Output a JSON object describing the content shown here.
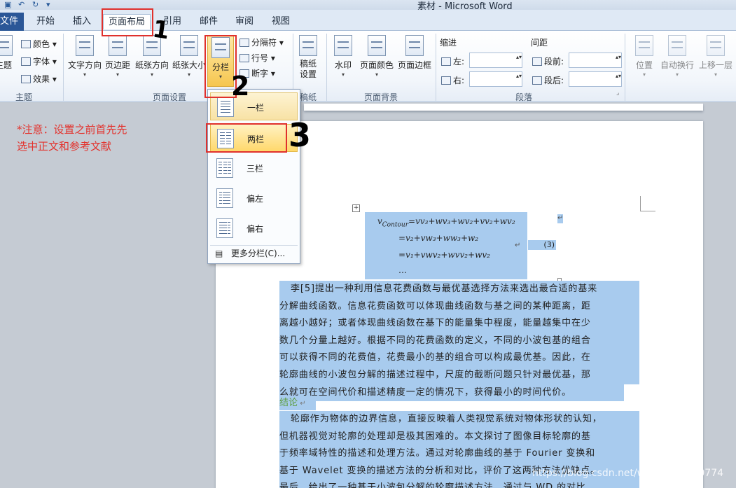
{
  "window": {
    "title": "素材 - Microsoft Word"
  },
  "tabs": [
    {
      "label": "文件"
    },
    {
      "label": "开始"
    },
    {
      "label": "插入"
    },
    {
      "label": "页面布局"
    },
    {
      "label": "引用"
    },
    {
      "label": "邮件"
    },
    {
      "label": "审阅"
    },
    {
      "label": "视图"
    }
  ],
  "ribbon": {
    "theme_group": {
      "label": "主题",
      "theme_button": "主题",
      "colors": "颜色",
      "fonts": "字体",
      "effects": "效果"
    },
    "page_setup": {
      "label": "页面设置",
      "text_direction": "文字方向",
      "margins": "页边距",
      "orientation": "纸张方向",
      "size": "纸张大小",
      "columns": "分栏",
      "breaks": "分隔符",
      "line_numbers": "行号",
      "hyphenation": "断字"
    },
    "draft": {
      "label": "稿纸",
      "button": "稿纸设置"
    },
    "background": {
      "label": "页面背景",
      "watermark": "水印",
      "page_color": "页面颜色",
      "page_borders": "页面边框"
    },
    "paragraph": {
      "label": "段落",
      "indent": "缩进",
      "left": "左:",
      "right": "右:",
      "spacing": "间距",
      "before": "段前:",
      "after": "段后:"
    },
    "arrange": {
      "position": "位置",
      "wrap": "自动换行",
      "bring_forward": "上移一层"
    }
  },
  "columns_menu": {
    "items": [
      {
        "label": "一栏",
        "columns": 1
      },
      {
        "label": "两栏",
        "columns": 2
      },
      {
        "label": "三栏",
        "columns": 3
      },
      {
        "label": "偏左",
        "columns": 2
      },
      {
        "label": "偏右",
        "columns": 2
      }
    ],
    "more": "更多分栏(C)..."
  },
  "annotation": {
    "note_line1": "*注意：设置之前首先先",
    "note_line2": "选中正文和参考文献",
    "step1": "1",
    "step2": "2",
    "step3": "3"
  },
  "document": {
    "formula": {
      "line1_sub": "Contour",
      "line1_rest": "=vv₃+wv₃+wv₂+vv₂+wv₂",
      "line2": "=v₂+vw₃+ww₃+w₂",
      "line3": "=v₁+vwv₂+wvv₂+wv₂",
      "line4": "…",
      "eqno": "(3)"
    },
    "para1": [
      "李[5]提出一种利用信息花费函数与最优基选择方法来选出最合适的基来",
      "分解曲线函数。信息花费函数可以体现曲线函数与基之间的某种距离，距",
      "离越小越好；或者体现曲线函数在基下的能量集中程度，能量越集中在少",
      "数几个分量上越好。根据不同的花费函数的定义，不同的小波包基的组合",
      "可以获得不同的花费值，花费最小的基的组合可以构成最优基。因此，在",
      "轮廓曲线的小波包分解的描述过程中，尺度的截断问题只针对最优基，那",
      "么就可在空间代价和描述精度一定的情况下，获得最小的时间代价。"
    ],
    "heading": "结论",
    "para2": [
      "轮廓作为物体的边界信息，直接反映着人类视觉系统对物体形状的认知，",
      "但机器视觉对轮廓的处理却是极其困难的。本文探讨了图像目标轮廓的基",
      "于频率域特性的描述和处理方法。通过对轮廓曲线的基于 Fourier 变换和",
      "基于 Wavelet 变换的描述方法的分析和对比，评价了这两种方法优缺点。",
      "最后，给出了一种基于小波包分解的轮廓描述方法，通过与 WD 的对比"
    ]
  },
  "watermark_text": "https://blog.csdn.net/weixin_43460774"
}
